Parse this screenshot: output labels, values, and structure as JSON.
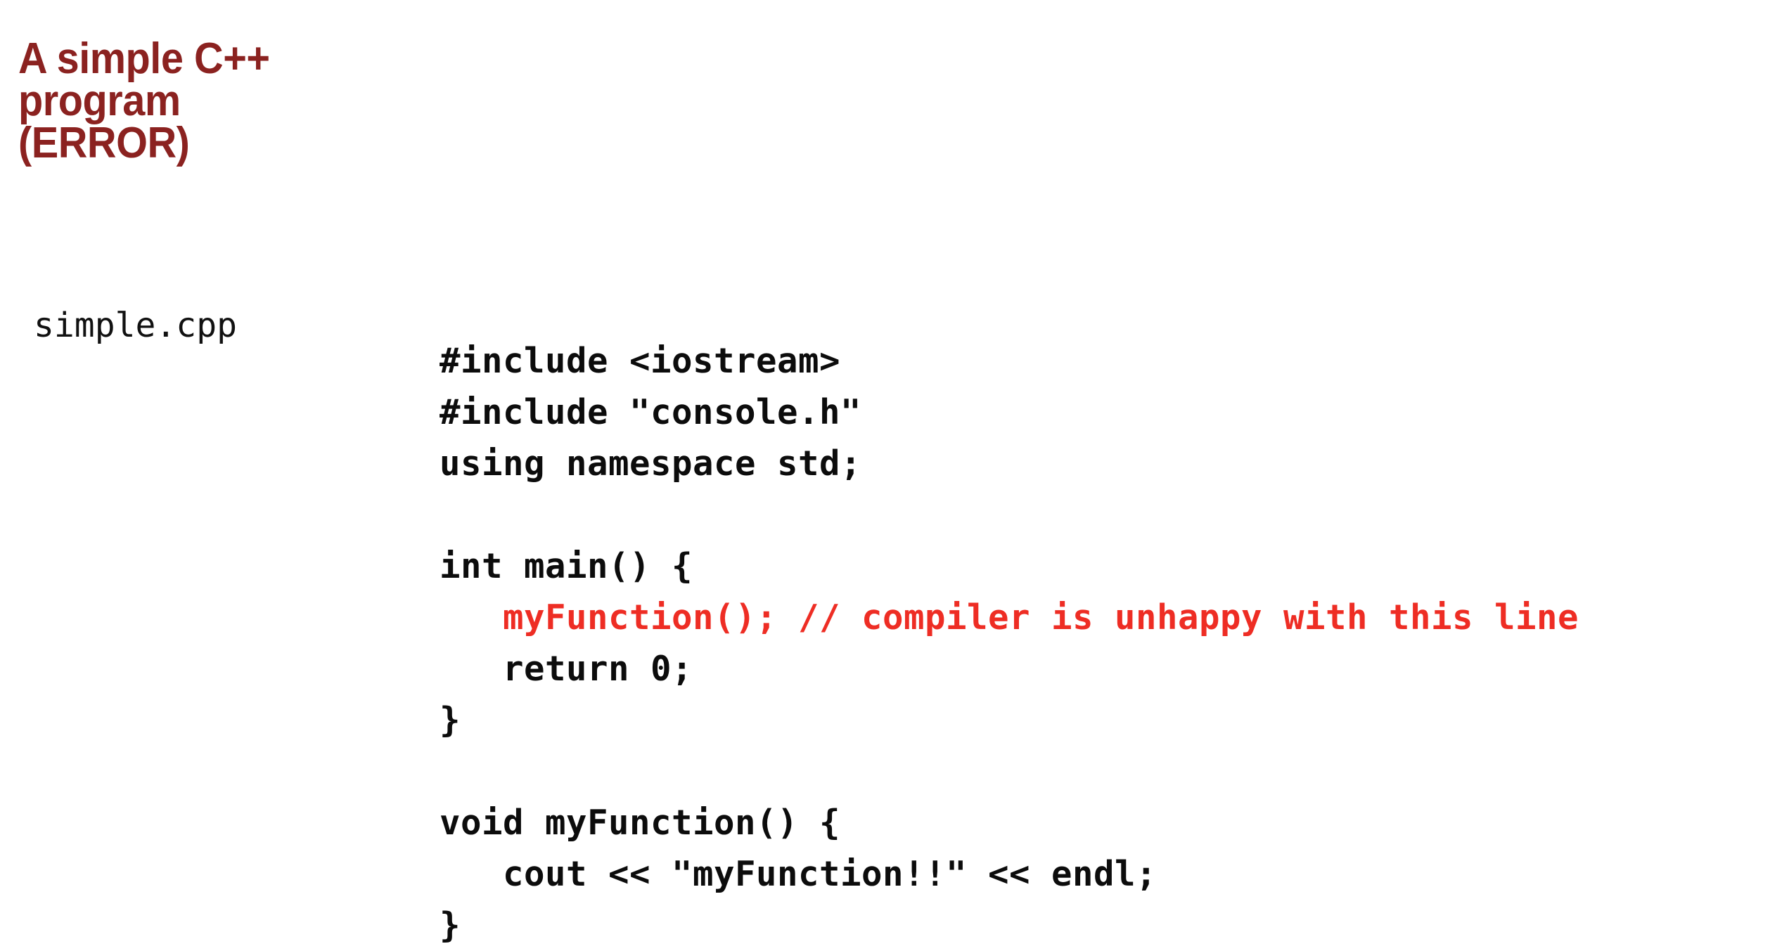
{
  "slide": {
    "background_color": "#ffffff",
    "title": {
      "text": "A simple C++\nprogram\n(ERROR)",
      "color": "#8b2220"
    },
    "file_label": {
      "text": "simple.cpp",
      "color": "#111111"
    },
    "code": {
      "language": "cpp",
      "default_color": "#0c0c0c",
      "error_color": "#ee2d24",
      "lines": [
        {
          "text": "#include <iostream>",
          "kind": "normal"
        },
        {
          "text": "#include \"console.h\"",
          "kind": "normal"
        },
        {
          "text": "using namespace std;",
          "kind": "normal"
        },
        {
          "text": "",
          "kind": "blank"
        },
        {
          "text": "int main() {",
          "kind": "normal"
        },
        {
          "text": "   myFunction(); // compiler is unhappy with this line",
          "kind": "error"
        },
        {
          "text": "   return 0;",
          "kind": "normal"
        },
        {
          "text": "}",
          "kind": "normal"
        },
        {
          "text": "",
          "kind": "blank"
        },
        {
          "text": "void myFunction() {",
          "kind": "normal"
        },
        {
          "text": "   cout << \"myFunction!!\" << endl;",
          "kind": "normal"
        },
        {
          "text": "}",
          "kind": "normal"
        }
      ]
    }
  }
}
